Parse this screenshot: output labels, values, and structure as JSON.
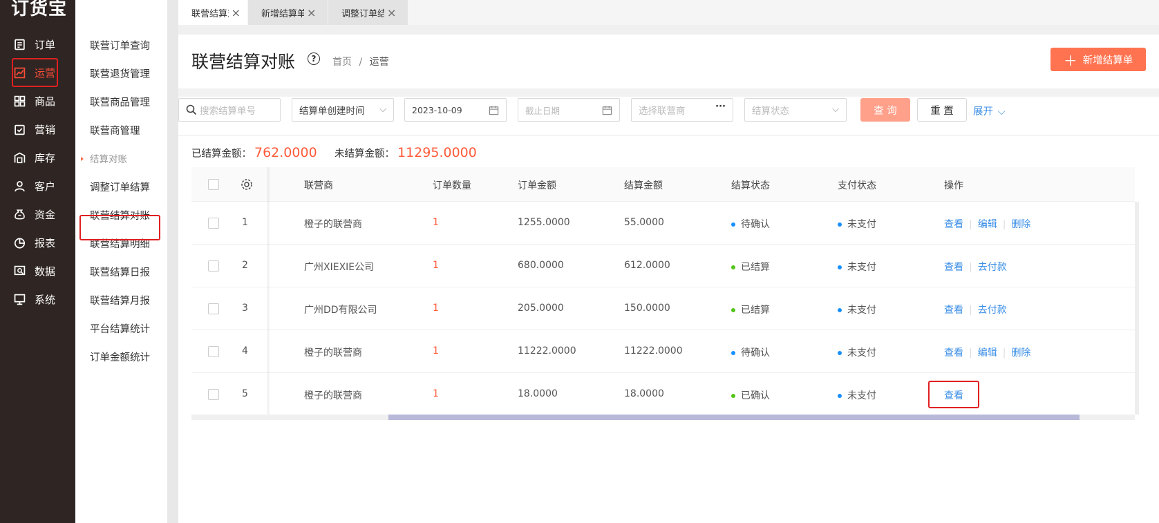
{
  "app": {
    "logo": "订货宝"
  },
  "nav": [
    {
      "label": "订单",
      "icon": "order-icon"
    },
    {
      "label": "运营",
      "icon": "operation-icon"
    },
    {
      "label": "商品",
      "icon": "goods-icon"
    },
    {
      "label": "营销",
      "icon": "marketing-icon"
    },
    {
      "label": "库存",
      "icon": "warehouse-icon"
    },
    {
      "label": "客户",
      "icon": "customer-icon"
    },
    {
      "label": "资金",
      "icon": "money-bag-icon"
    },
    {
      "label": "报表",
      "icon": "pie-chart-icon"
    },
    {
      "label": "数据",
      "icon": "data-icon"
    },
    {
      "label": "系统",
      "icon": "monitor-icon"
    }
  ],
  "subnav": [
    {
      "label": "联营订单查询"
    },
    {
      "label": "联营退货管理"
    },
    {
      "label": "联营商品管理"
    },
    {
      "label": "联营商管理"
    },
    {
      "label": "结算对账"
    },
    {
      "label": "调整订单结算"
    },
    {
      "label": "联营结算对账"
    },
    {
      "label": "联营结算明细"
    },
    {
      "label": "联营结算日报"
    },
    {
      "label": "联营结算月报"
    },
    {
      "label": "平台结算统计"
    },
    {
      "label": "订单金额统计"
    }
  ],
  "tabs": [
    {
      "label": "联营结算对账"
    },
    {
      "label": "新增结算单"
    },
    {
      "label": "调整订单结算"
    }
  ],
  "page": {
    "title": "联营结算对账",
    "help": "?",
    "breadcrumb": [
      "首页",
      "运营"
    ],
    "breadcrumb_sep": "/",
    "add_button": "新增结算单"
  },
  "filters": {
    "search_placeholder": "搜索结算单号",
    "date_type": "结算单创建时间",
    "start_date": "2023-10-09",
    "end_placeholder": "截止日期",
    "partner_placeholder": "选择联营商",
    "status_placeholder": "结算状态",
    "query": "查 询",
    "reset": "重 置",
    "expand": "展开"
  },
  "summary": {
    "settled_label": "已结算金额：",
    "settled_value": "762.0000",
    "unsettled_label": "未结算金额：",
    "unsettled_value": "11295.0000"
  },
  "table": {
    "columns": [
      "联营商",
      "订单数量",
      "订单金额",
      "结算金额",
      "结算状态",
      "支付状态",
      "操作"
    ],
    "rows": [
      {
        "no": "1",
        "partner": "橙子的联营商",
        "qty": "1",
        "amount": "1255.0000",
        "settle": "55.0000",
        "status": "待确认",
        "status_color": "#1890ff",
        "pay": "未支付",
        "ops": [
          "查看",
          "编辑",
          "删除"
        ]
      },
      {
        "no": "2",
        "partner": "广州XIEXIE公司",
        "qty": "1",
        "amount": "680.0000",
        "settle": "612.0000",
        "status": "已结算",
        "status_color": "#52c41a",
        "pay": "未支付",
        "ops": [
          "查看",
          "去付款"
        ]
      },
      {
        "no": "3",
        "partner": "广州DD有限公司",
        "qty": "1",
        "amount": "205.0000",
        "settle": "150.0000",
        "status": "已结算",
        "status_color": "#52c41a",
        "pay": "未支付",
        "ops": [
          "查看",
          "去付款"
        ]
      },
      {
        "no": "4",
        "partner": "橙子的联营商",
        "qty": "1",
        "amount": "11222.0000",
        "settle": "11222.0000",
        "status": "待确认",
        "status_color": "#1890ff",
        "pay": "未支付",
        "ops": [
          "查看",
          "编辑",
          "删除"
        ]
      },
      {
        "no": "5",
        "partner": "橙子的联营商",
        "qty": "1",
        "amount": "18.0000",
        "settle": "18.0000",
        "status": "已确认",
        "status_color": "#52c41a",
        "pay": "未支付",
        "ops": [
          "查看"
        ]
      }
    ]
  },
  "colors": {
    "accent": "#ff7350",
    "link": "#3a8ee6",
    "highlight": "#e02020",
    "pay_dot": "#1890ff"
  }
}
